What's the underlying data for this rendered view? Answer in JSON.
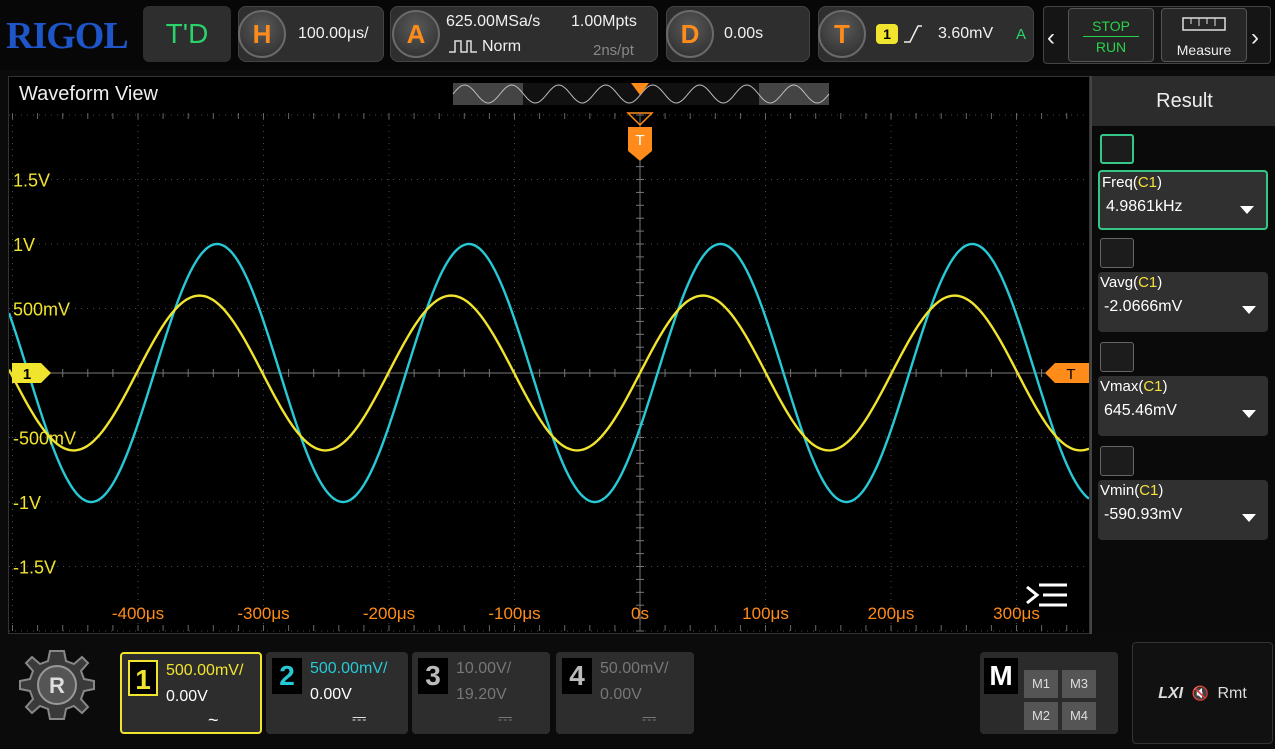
{
  "brand": "RIGOL",
  "top": {
    "mode": "T'D",
    "horizontal": {
      "letter": "H",
      "scale": "100.00μs/"
    },
    "acquire": {
      "letter": "A",
      "sample_rate": "625.00MSa/s",
      "depth": "1.00Mpts",
      "mode": "Norm",
      "resolution": "2ns/pt"
    },
    "delay": {
      "letter": "D",
      "value": "0.00s"
    },
    "trigger": {
      "letter": "T",
      "source": "1",
      "level": "3.60mV",
      "sweep": "A"
    },
    "stop": "STOP",
    "run": "RUN",
    "measure": "Measure"
  },
  "waveform": {
    "title": "Waveform View",
    "y_labels": [
      "1.5V",
      "1V",
      "500mV",
      "-500mV",
      "-1V",
      "-1.5V"
    ],
    "x_labels": [
      "-400μs",
      "-300μs",
      "-200μs",
      "-100μs",
      "0s",
      "100μs",
      "200μs",
      "300μs",
      "400μs"
    ],
    "ch1_marker": "1",
    "trigger_marker": "T",
    "colors": {
      "ch1": "#f1e42e",
      "ch2": "#27c9d6",
      "grid": "#4a4a4a",
      "axis_label": "#f1e42e",
      "time_label": "#ff8c1a",
      "trigger": "#ff8c1a"
    }
  },
  "result": {
    "title": "Result",
    "items": [
      {
        "name": "Freq",
        "channel": "C1",
        "value": "4.9861kHz"
      },
      {
        "name": "Vavg",
        "channel": "C1",
        "value": "-2.0666mV"
      },
      {
        "name": "Vmax",
        "channel": "C1",
        "value": "645.46mV"
      },
      {
        "name": "Vmin",
        "channel": "C1",
        "value": "-590.93mV"
      }
    ]
  },
  "channels": [
    {
      "num": "1",
      "scale": "500.00mV/",
      "offset": "0.00V",
      "coupling": "~",
      "color": "#f1e42e",
      "active": true
    },
    {
      "num": "2",
      "scale": "500.00mV/",
      "offset": "0.00V",
      "coupling": "⎓",
      "color": "#27c9d6",
      "active": true
    },
    {
      "num": "3",
      "scale": "10.00V/",
      "offset": "19.20V",
      "coupling": "⎓",
      "color": "#777777",
      "active": false
    },
    {
      "num": "4",
      "scale": "50.00mV/",
      "offset": "0.00V",
      "coupling": "⎓",
      "color": "#777777",
      "active": false
    }
  ],
  "math": {
    "label": "M",
    "slots": [
      "M1",
      "M3",
      "M2",
      "M4"
    ]
  },
  "status": {
    "lxi": "LXI",
    "mute": "🔇",
    "remote": "Rmt"
  }
}
